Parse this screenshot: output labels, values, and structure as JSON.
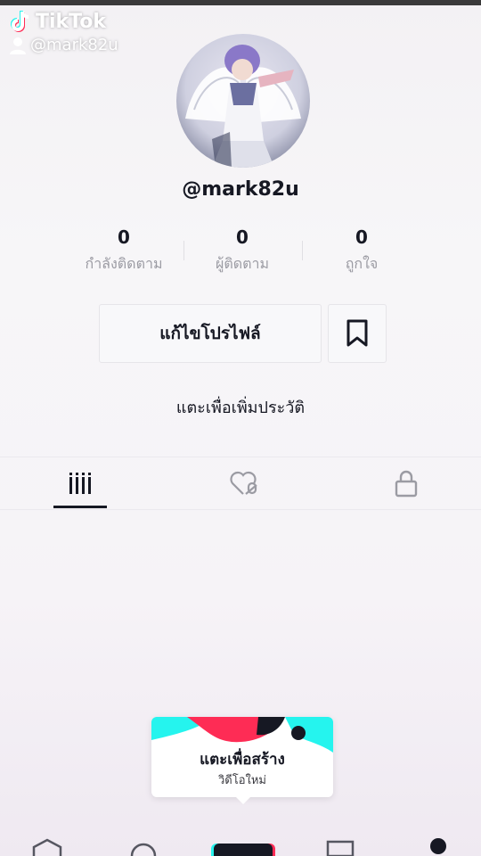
{
  "watermark": {
    "brand": "TikTok",
    "username": "@mark82u"
  },
  "profile": {
    "handle": "@mark82u",
    "bio_prompt": "แตะเพื่อเพิ่มประวัติ"
  },
  "stats": [
    {
      "value": "0",
      "label": "กำลังติดตาม"
    },
    {
      "value": "0",
      "label": "ผู้ติดตาม"
    },
    {
      "value": "0",
      "label": "ถูกใจ"
    }
  ],
  "actions": {
    "edit_profile": "แก้ไขโปรไฟล์",
    "bookmark_icon": "bookmark-icon"
  },
  "tabs": [
    {
      "icon": "videos-grid-icon",
      "active": true
    },
    {
      "icon": "liked-heart-icon",
      "active": false
    },
    {
      "icon": "lock-icon",
      "active": false
    }
  ],
  "create_popup": {
    "title": "แตะเพื่อสร้าง",
    "subtitle": "วิดีโอใหม่"
  },
  "nav": [
    "home-icon",
    "discover-icon",
    "create-icon",
    "inbox-icon",
    "profile-icon"
  ],
  "colors": {
    "cyan": "#25f4ee",
    "red": "#fe2c55",
    "text": "#161823",
    "muted": "#9b9ba3"
  }
}
